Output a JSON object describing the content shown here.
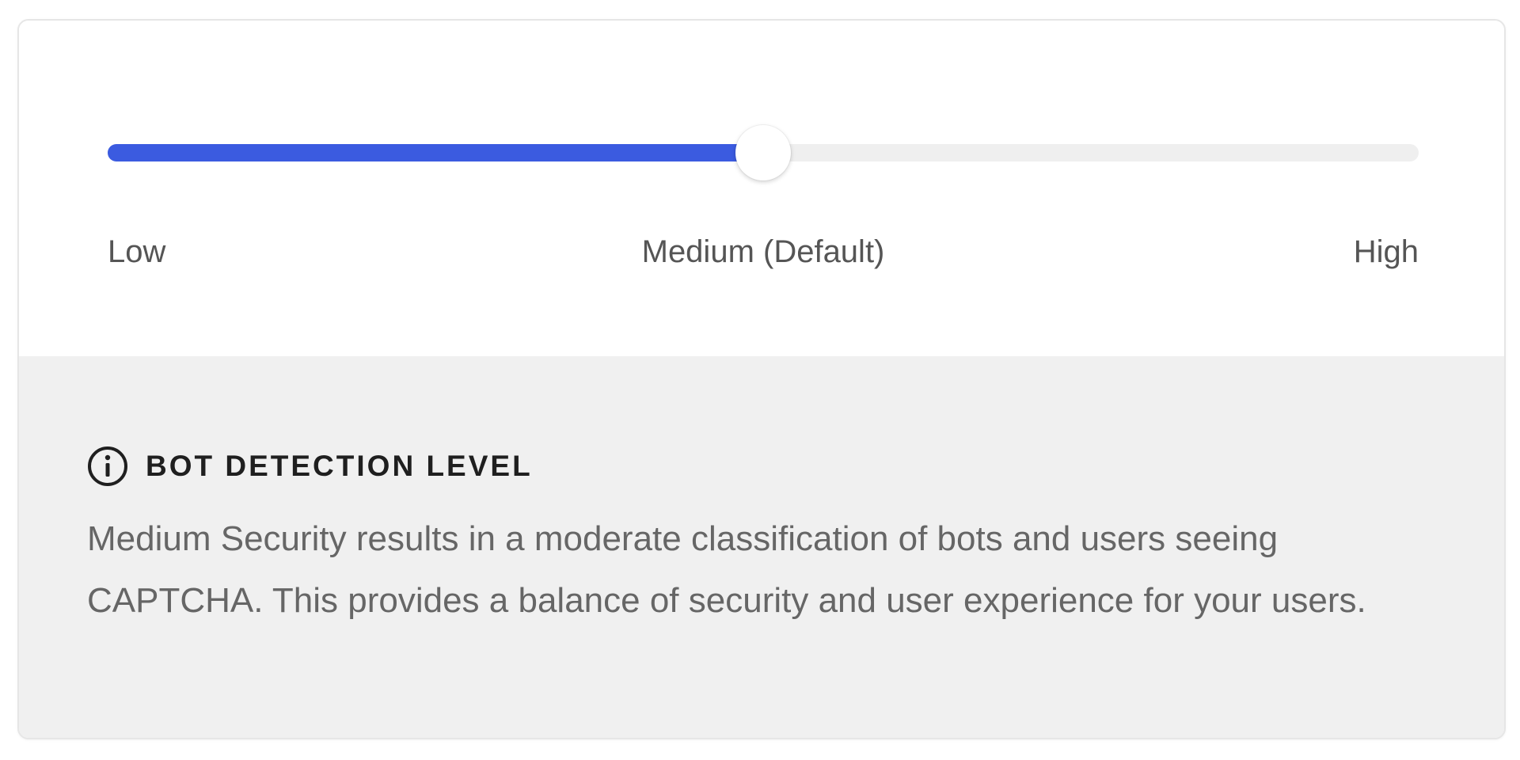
{
  "slider": {
    "value": 0.5,
    "labels": {
      "low": "Low",
      "medium": "Medium (Default)",
      "high": "High"
    }
  },
  "info": {
    "icon": "info-icon",
    "title": "BOT DETECTION LEVEL",
    "description": "Medium Security results in a moderate classification of bots and users seeing CAPTCHA. This provides a balance of security and user experience for your users."
  },
  "colors": {
    "accent": "#3b5be0",
    "track": "#efefef",
    "info_background": "#f0f0f0"
  }
}
